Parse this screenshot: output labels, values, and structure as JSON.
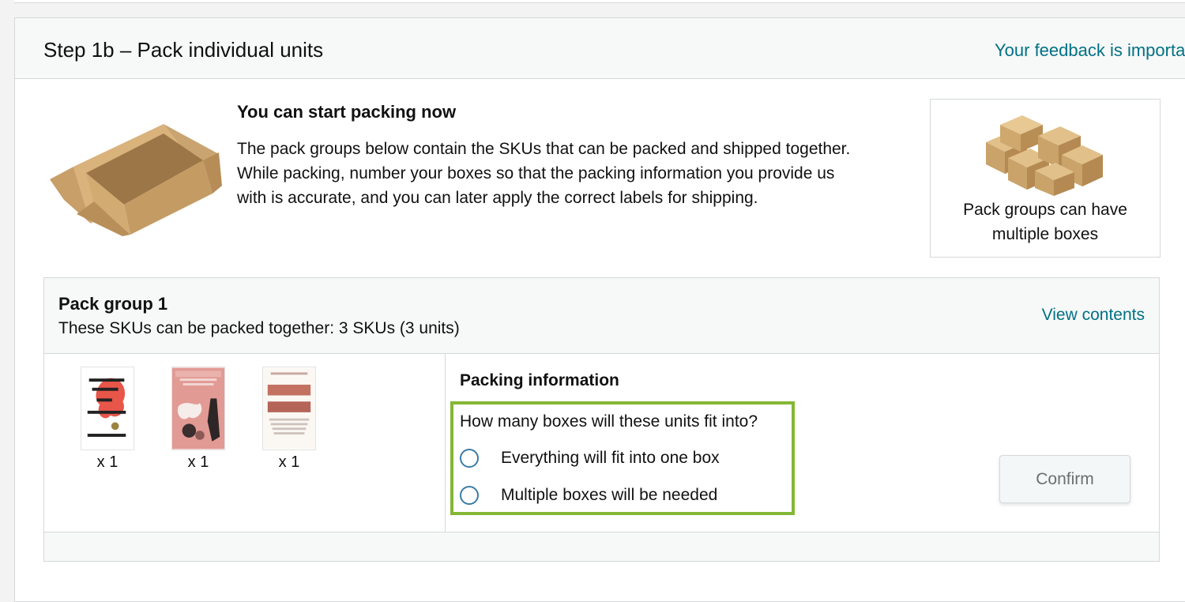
{
  "header": {
    "step_title": "Step 1b – Pack individual units",
    "feedback_link": "Your feedback is importa"
  },
  "intro": {
    "heading": "You can start packing now",
    "body_lines": [
      "The pack groups below contain the SKUs that can be packed and shipped together.",
      "While packing, number your boxes so that the packing information you provide us",
      "with is accurate, and you can later apply the correct labels for shipping."
    ],
    "illustration": "open-cardboard-box-icon"
  },
  "tip_card": {
    "text_lines": [
      "Pack groups can have",
      "multiple boxes"
    ],
    "illustration": "stacked-boxes-icon"
  },
  "pack_group": {
    "title": "Pack group 1",
    "subtitle": "These SKUs can be packed together: 3 SKUs (3 units)",
    "view_contents": "View contents",
    "items": [
      {
        "cover": "book-cover-brief-wondrous-life",
        "qty": "x 1"
      },
      {
        "cover": "book-cover-pink",
        "qty": "x 1"
      },
      {
        "cover": "book-cover-cork-dork",
        "qty": "x 1"
      }
    ],
    "packing_info": {
      "title": "Packing information",
      "question": "How many boxes will these units fit into?",
      "options": [
        {
          "label": "Everything will fit into one box",
          "selected": false
        },
        {
          "label": "Multiple boxes will be needed",
          "selected": false
        }
      ],
      "confirm_label": "Confirm"
    }
  },
  "colors": {
    "link": "#007185",
    "highlight_border": "#84b734",
    "radio_border": "#3a7ca5",
    "panel_header_bg": "#f7f8f8"
  }
}
